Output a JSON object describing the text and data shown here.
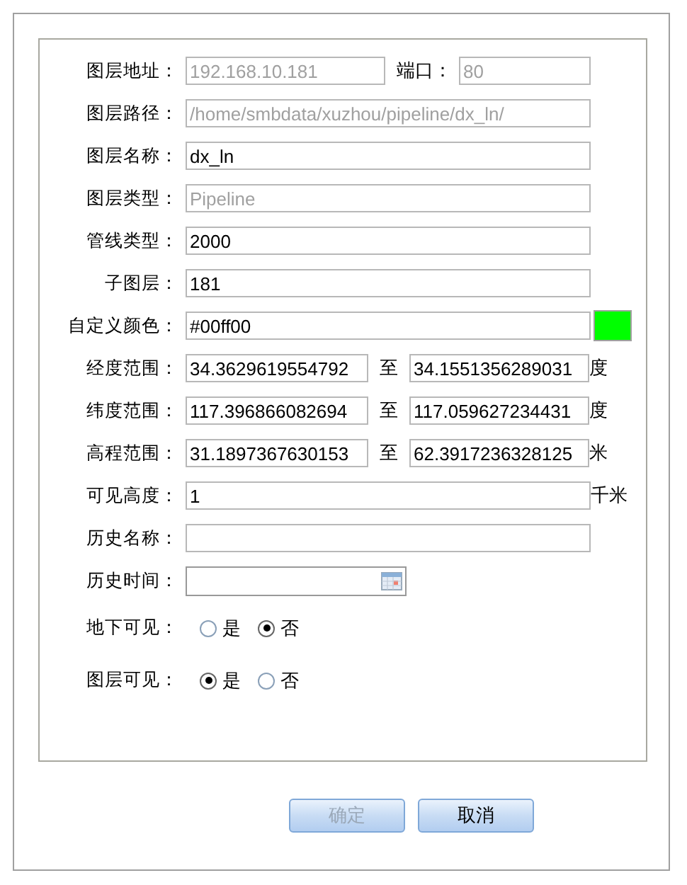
{
  "rows": [
    {
      "kind": "address",
      "label": "图层地址：",
      "value": "192.168.10.181",
      "disabled": true,
      "port_label": "端口：",
      "port_value": "80",
      "port_disabled": true
    },
    {
      "kind": "text",
      "label": "图层路径：",
      "value": "/home/smbdata/xuzhou/pipeline/dx_ln/",
      "disabled": true
    },
    {
      "kind": "text",
      "label": "图层名称：",
      "value": "dx_ln",
      "disabled": false
    },
    {
      "kind": "text",
      "label": "图层类型：",
      "value": "Pipeline",
      "disabled": true
    },
    {
      "kind": "text",
      "label": "管线类型：",
      "value": "2000",
      "disabled": false
    },
    {
      "kind": "text",
      "label": "子图层：",
      "value": "181",
      "disabled": false
    },
    {
      "kind": "color",
      "label": "自定义颜色：",
      "value": "#00ff00",
      "color": "#00ff00"
    },
    {
      "kind": "range",
      "label": "经度范围：",
      "from": "34.3629619554792",
      "sep": "至",
      "to": "34.1551356289031",
      "unit": "度"
    },
    {
      "kind": "range",
      "label": "纬度范围：",
      "from": "117.396866082694",
      "sep": "至",
      "to": "117.059627234431",
      "unit": "度"
    },
    {
      "kind": "range",
      "label": "高程范围：",
      "from": "31.1897367630153",
      "sep": "至",
      "to": "62.3917236328125",
      "unit": "米"
    },
    {
      "kind": "unit",
      "label": "可见高度：",
      "value": "1",
      "unit": "千米"
    },
    {
      "kind": "text",
      "label": "历史名称："
    },
    {
      "kind": "date",
      "label": "历史时间："
    },
    {
      "kind": "radio",
      "label": "地下可见：",
      "options": [
        {
          "label": "是",
          "selected": false
        },
        {
          "label": "否",
          "selected": true
        }
      ]
    },
    {
      "kind": "radio",
      "label": "图层可见：",
      "options": [
        {
          "label": "是",
          "selected": true
        },
        {
          "label": "否",
          "selected": false
        }
      ]
    }
  ],
  "buttons": [
    {
      "label": "确定",
      "disabled": true
    },
    {
      "label": "取消",
      "disabled": false
    }
  ]
}
